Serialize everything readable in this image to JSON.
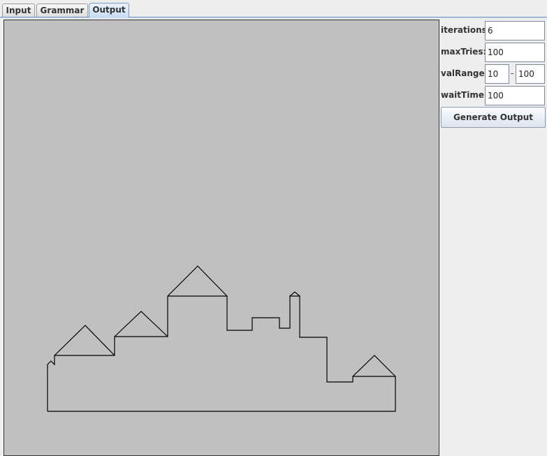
{
  "tabs": [
    {
      "label": "Input",
      "active": false
    },
    {
      "label": "Grammar",
      "active": false
    },
    {
      "label": "Output",
      "active": true
    }
  ],
  "params": {
    "iterations": {
      "label": "iterations:",
      "value": "6"
    },
    "maxTries": {
      "label": "maxTries:",
      "value": "100"
    },
    "valRange": {
      "label": "valRange:",
      "min": "10",
      "separator": "-",
      "max": "100"
    },
    "waitTime": {
      "label": "waitTime:",
      "value": "100"
    }
  },
  "generate_button": {
    "label": "Generate Output"
  },
  "colors": {
    "canvas_background": "#c0c0c0",
    "drawing_stroke": "#000000",
    "active_tab": "#c7dcf3"
  }
}
